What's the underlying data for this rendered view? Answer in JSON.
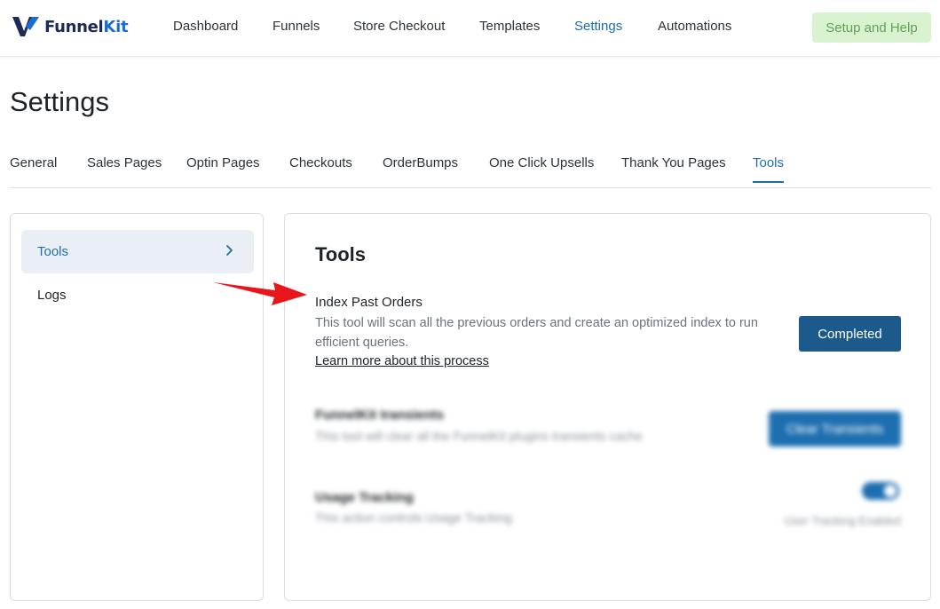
{
  "header": {
    "brand_prefix": "Funnel",
    "brand_suffix": "Kit",
    "nav": [
      {
        "label": "Dashboard"
      },
      {
        "label": "Funnels"
      },
      {
        "label": "Store Checkout"
      },
      {
        "label": "Templates"
      },
      {
        "label": "Settings",
        "active": true
      },
      {
        "label": "Automations"
      }
    ],
    "help_label": "Setup and Help"
  },
  "page": {
    "title": "Settings"
  },
  "tabs": [
    {
      "label": "General"
    },
    {
      "label": "Sales Pages"
    },
    {
      "label": "Optin Pages"
    },
    {
      "label": "Checkouts"
    },
    {
      "label": "OrderBumps"
    },
    {
      "label": "One Click Upsells"
    },
    {
      "label": "Thank You Pages"
    },
    {
      "label": "Tools",
      "active": true
    }
  ],
  "sidebar": {
    "items": [
      {
        "label": "Tools",
        "active": true,
        "icon": "chevron-right-icon"
      },
      {
        "label": "Logs"
      }
    ]
  },
  "main": {
    "title": "Tools",
    "index_tool": {
      "title": "Index Past Orders",
      "description": "This tool will scan all the previous orders and create an optimized index to run efficient queries.",
      "link": "Learn more about this process",
      "button": "Completed"
    },
    "transients_tool": {
      "title": "FunnelKit transients",
      "description": "This tool will clear all the FunnelKit plugins transients cache",
      "button": "Clear Transients"
    },
    "usage_tool": {
      "title": "Usage Tracking",
      "description": "This action controls Usage Tracking",
      "status": "User Tracking Enabled",
      "enabled": true
    }
  },
  "colors": {
    "accent": "#1d6fa8",
    "primary_button": "#1d5a8c",
    "help_button_bg": "#d9f2cf",
    "annotation_arrow": "#e8161a"
  }
}
